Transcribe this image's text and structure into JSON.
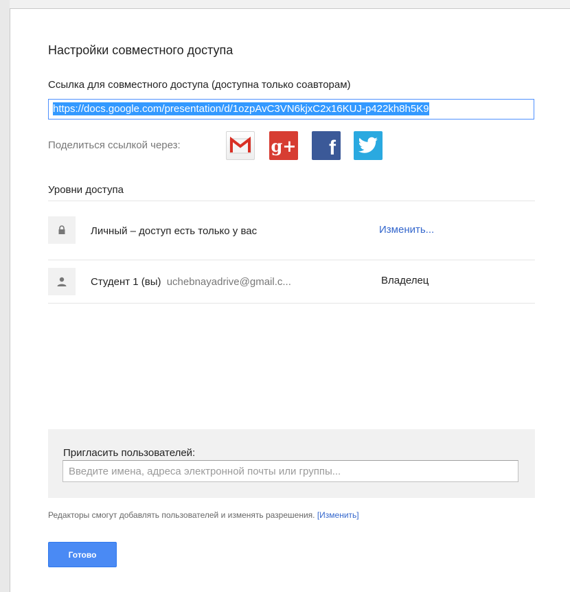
{
  "dialog": {
    "title": "Настройки совместного доступа"
  },
  "link": {
    "label": "Ссылка для совместного доступа (доступна только соавторам)",
    "url": "https://docs.google.com/presentation/d/1ozpAvC3VN6kjxC2x16KUJ-p422kh8h5K9"
  },
  "share": {
    "label": "Поделиться ссылкой через:",
    "icons": [
      "gmail-icon",
      "google-plus-icon",
      "facebook-icon",
      "twitter-icon"
    ],
    "gplus_text": "g+",
    "facebook_text": "f"
  },
  "access": {
    "label": "Уровни доступа",
    "visibility": {
      "text": "Личный – доступ есть только у вас",
      "change_label": "Изменить...",
      "icon": "lock-icon"
    },
    "owner": {
      "name": "Студент 1 (вы)",
      "email": "uchebnayadrive@gmail.c...",
      "role": "Владелец",
      "icon": "person-icon"
    }
  },
  "invite": {
    "label": "Пригласить пользователей:",
    "placeholder": "Введите имена, адреса электронной почты или группы..."
  },
  "footer": {
    "note": "Редакторы смогут добавлять пользователей и изменять разрешения.",
    "change_link": "[Изменить]",
    "done_label": "Готово"
  },
  "colors": {
    "accent": "#4a8af4",
    "link": "#3366cc",
    "gplus": "#d73d32",
    "facebook": "#3b5998",
    "twitter": "#2aa9e0"
  }
}
